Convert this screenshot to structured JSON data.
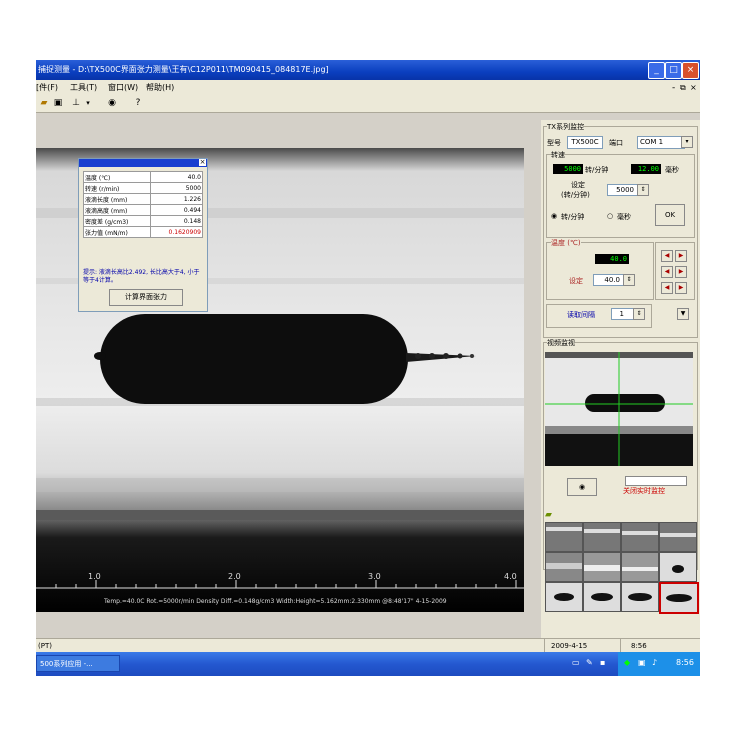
{
  "window": {
    "title": "捕捉测量 - D:\\TX500C界面张力测量\\王有\\C12P011\\TM090415_084817E.jpg]"
  },
  "menu": {
    "items": [
      "[件(F)",
      "工具(T)",
      "窗口(W)",
      "帮助(H)"
    ]
  },
  "results_panel": {
    "rows": [
      {
        "label": "温度 (℃)",
        "value": "40.0"
      },
      {
        "label": "转速 (r/min)",
        "value": "5000"
      },
      {
        "label": "液滴长度 (mm)",
        "value": "1.226"
      },
      {
        "label": "液滴高度 (mm)",
        "value": "0.494"
      },
      {
        "label": "密度差 (g/cm3)",
        "value": "0.148"
      },
      {
        "label": "张力值 (mN/m)",
        "value": "0.1620909"
      }
    ],
    "note": "提示: 液滴长高比2.492, 长比高大于4, 小于等于4计算。",
    "calc_button": "计算界面张力"
  },
  "image_overlay": {
    "axis_ticks": [
      "1.0",
      "2.0",
      "3.0",
      "4.0"
    ],
    "info": "Temp.=40.0C  Rot.=5000r/min  Density Diff.=0.148g/cm3  Width:Height=5.162mm:2.330mm  @8:48'17\" 4-15-2009"
  },
  "right_panel": {
    "group_title": "TX系列监控",
    "model_label": "型号",
    "model_value": "TX500C",
    "port_label": "端口",
    "port_value": "COM 1",
    "speed_group_label": "转速",
    "speed_lcd": "5000",
    "speed_unit": "转/分钟",
    "period_lcd": "12.00",
    "period_unit": "毫秒",
    "set_label_1": "设定",
    "set_label_2": "(转/分钟)",
    "set_value": "5000",
    "radio_rpm": "转/分钟",
    "radio_ms": "毫秒",
    "ok_button": "OK",
    "temp_group_label": "温度 (℃)",
    "temp_lcd": "40.0",
    "temp_set_label": "设定",
    "temp_set_value": "40.0",
    "interval_label": "读取间隔",
    "interval_value": "1",
    "video_group_label": "视频监视",
    "video_button_label": "关闭实时监控"
  },
  "statusbar": {
    "left": "(PT)",
    "date": "2009-4-15",
    "time": "8:56"
  },
  "taskbar": {
    "task": "500系列应用 -...",
    "clock": "8:56"
  }
}
